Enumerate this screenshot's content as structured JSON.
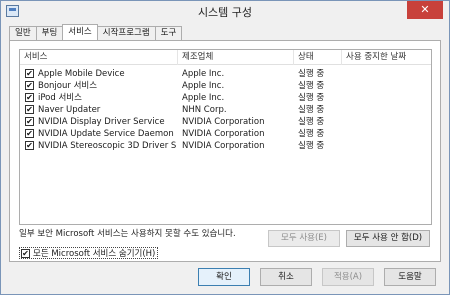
{
  "window": {
    "title": "시스템 구성",
    "close_glyph": "✕"
  },
  "tabs": [
    {
      "label": "일반",
      "active": false
    },
    {
      "label": "부팅",
      "active": false
    },
    {
      "label": "서비스",
      "active": true
    },
    {
      "label": "시작프로그램",
      "active": false
    },
    {
      "label": "도구",
      "active": false
    }
  ],
  "services": {
    "columns": [
      "서비스",
      "제조업체",
      "상태",
      "사용 중지한 날짜"
    ],
    "rows": [
      {
        "checked": true,
        "name": "Apple Mobile Device",
        "vendor": "Apple Inc.",
        "status": "실행 중"
      },
      {
        "checked": true,
        "name": "Bonjour 서비스",
        "vendor": "Apple Inc.",
        "status": "실행 중"
      },
      {
        "checked": true,
        "name": "iPod 서비스",
        "vendor": "Apple Inc.",
        "status": "실행 중"
      },
      {
        "checked": true,
        "name": "Naver Updater",
        "vendor": "NHN Corp.",
        "status": "실행 중"
      },
      {
        "checked": true,
        "name": "NVIDIA Display Driver Service",
        "vendor": "NVIDIA Corporation",
        "status": "실행 중"
      },
      {
        "checked": true,
        "name": "NVIDIA Update Service Daemon",
        "vendor": "NVIDIA Corporation",
        "status": "실행 중"
      },
      {
        "checked": true,
        "name": "NVIDIA Stereoscopic 3D Driver Ser...",
        "vendor": "NVIDIA Corporation",
        "status": "실행 중"
      }
    ]
  },
  "footnote": "일부 보안 Microsoft 서비스는 사용하지 못할 수도 있습니다.",
  "buttons": {
    "enable_all": "모두 사용(E)",
    "disable_all": "모두 사용 안 함(D)",
    "hide_ms": "모든 Microsoft 서비스 숨기기(H)",
    "hide_ms_checked": true,
    "ok": "확인",
    "cancel": "취소",
    "apply": "적용(A)",
    "help": "도움말"
  },
  "check_glyph": "✔"
}
